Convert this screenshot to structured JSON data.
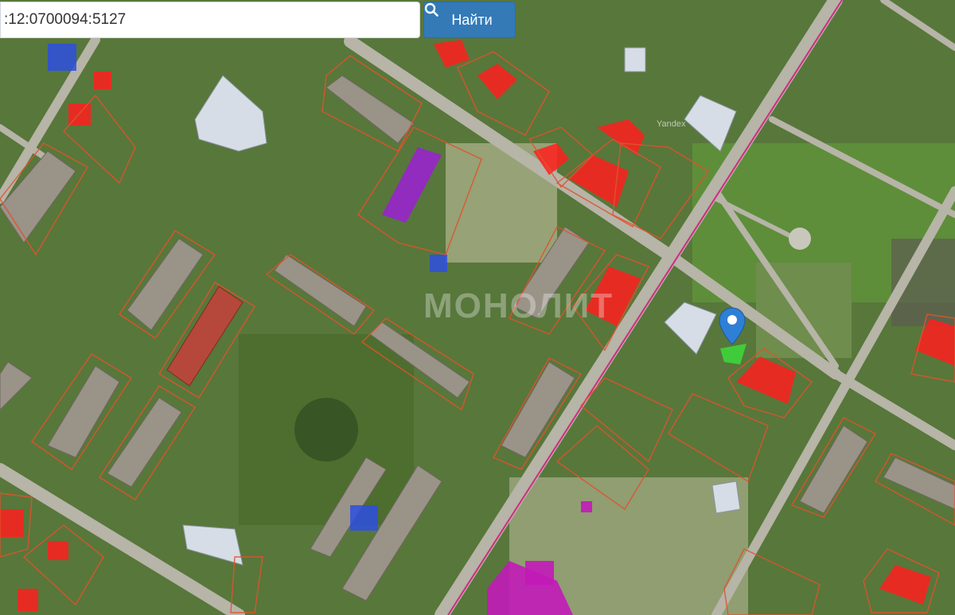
{
  "search": {
    "value": ":12:0700094:5127",
    "button_label": "Найти"
  },
  "map": {
    "watermark": "МОНОЛИТ",
    "provider": "Yandex"
  },
  "colors": {
    "accent": "#337ab7",
    "parcel_outline": "#e2522c",
    "parcel_fill_red": "#ff1f1f",
    "parcel_fill_magenta": "#c21ab8",
    "parcel_fill_purple": "#9b1fd6",
    "marker_blue": "#2e7fd6",
    "selected_parcel": "#3fd13a"
  },
  "icons": {
    "search": "magnifier-icon",
    "marker": "map-pin-icon"
  }
}
